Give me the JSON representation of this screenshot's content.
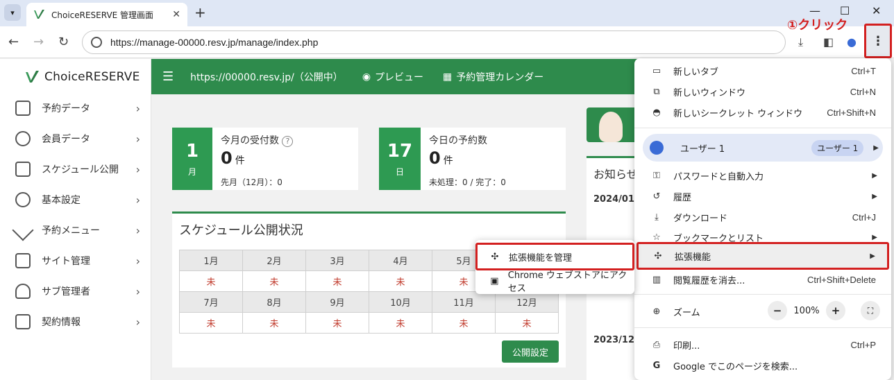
{
  "browser": {
    "tab_title": "ChoiceRESERVE 管理画面",
    "url": "https://manage-00000.resv.jp/manage/index.php",
    "new_tab": "+",
    "minimize": "—",
    "maximize": "☐",
    "close": "✕"
  },
  "annotation": {
    "click_label": "①クリック"
  },
  "sidebar": {
    "logo": "ChoiceRESERVE",
    "items": [
      {
        "label": "予約データ"
      },
      {
        "label": "会員データ"
      },
      {
        "label": "スケジュール公開"
      },
      {
        "label": "基本設定"
      },
      {
        "label": "予約メニュー"
      },
      {
        "label": "サイト管理"
      },
      {
        "label": "サブ管理者"
      },
      {
        "label": "契約情報"
      }
    ]
  },
  "header": {
    "site": "https://00000.resv.jp/（公開中）",
    "preview": "プレビュー",
    "calendar": "予約管理カレンダー"
  },
  "stats": {
    "monthly": {
      "num": "1",
      "unit": "月",
      "title": "今月の受付数",
      "count": "0",
      "count_unit": "件",
      "sub": "先月（12月）：0"
    },
    "daily": {
      "num": "17",
      "unit": "日",
      "title": "今日の予約数",
      "count": "0",
      "count_unit": "件",
      "sub": "未処理：0 / 完了：0"
    }
  },
  "schedule": {
    "title": "スケジュール公開状況",
    "months_row1": [
      "1月",
      "2月",
      "3月",
      "4月",
      "5月",
      ""
    ],
    "status_row1": [
      "未",
      "未",
      "未",
      "未",
      "未",
      ""
    ],
    "months_row2": [
      "7月",
      "8月",
      "9月",
      "10月",
      "11月",
      "12月"
    ],
    "status_row2": [
      "未",
      "未",
      "未",
      "未",
      "未",
      "未"
    ],
    "publish_button": "公開設定"
  },
  "notice": {
    "title": "お知らせ",
    "date1": "2024/01",
    "date2": "2023/12"
  },
  "chrome_menu": {
    "new_tab": {
      "label": "新しいタブ",
      "shortcut": "Ctrl+T"
    },
    "new_window": {
      "label": "新しいウィンドウ",
      "shortcut": "Ctrl+N"
    },
    "incognito": {
      "label": "新しいシークレット ウィンドウ",
      "shortcut": "Ctrl+Shift+N"
    },
    "profile": {
      "label": "ユーザー 1",
      "badge": "ユーザー 1"
    },
    "passwords": {
      "label": "パスワードと自動入力"
    },
    "history": {
      "label": "履歴"
    },
    "downloads": {
      "label": "ダウンロード",
      "shortcut": "Ctrl+J"
    },
    "bookmarks": {
      "label": "ブックマークとリスト"
    },
    "extensions": {
      "label": "拡張機能"
    },
    "clear": {
      "label": "閲覧履歴を消去...",
      "shortcut": "Ctrl+Shift+Delete"
    },
    "zoom": {
      "label": "ズーム",
      "minus": "−",
      "value": "100%",
      "plus": "+"
    },
    "print": {
      "label": "印刷...",
      "shortcut": "Ctrl+P"
    },
    "search": {
      "label": "Google でこのページを検索..."
    }
  },
  "extensions_submenu": {
    "manage": "拡張機能を管理",
    "store": "Chrome ウェブストアにアクセス"
  }
}
